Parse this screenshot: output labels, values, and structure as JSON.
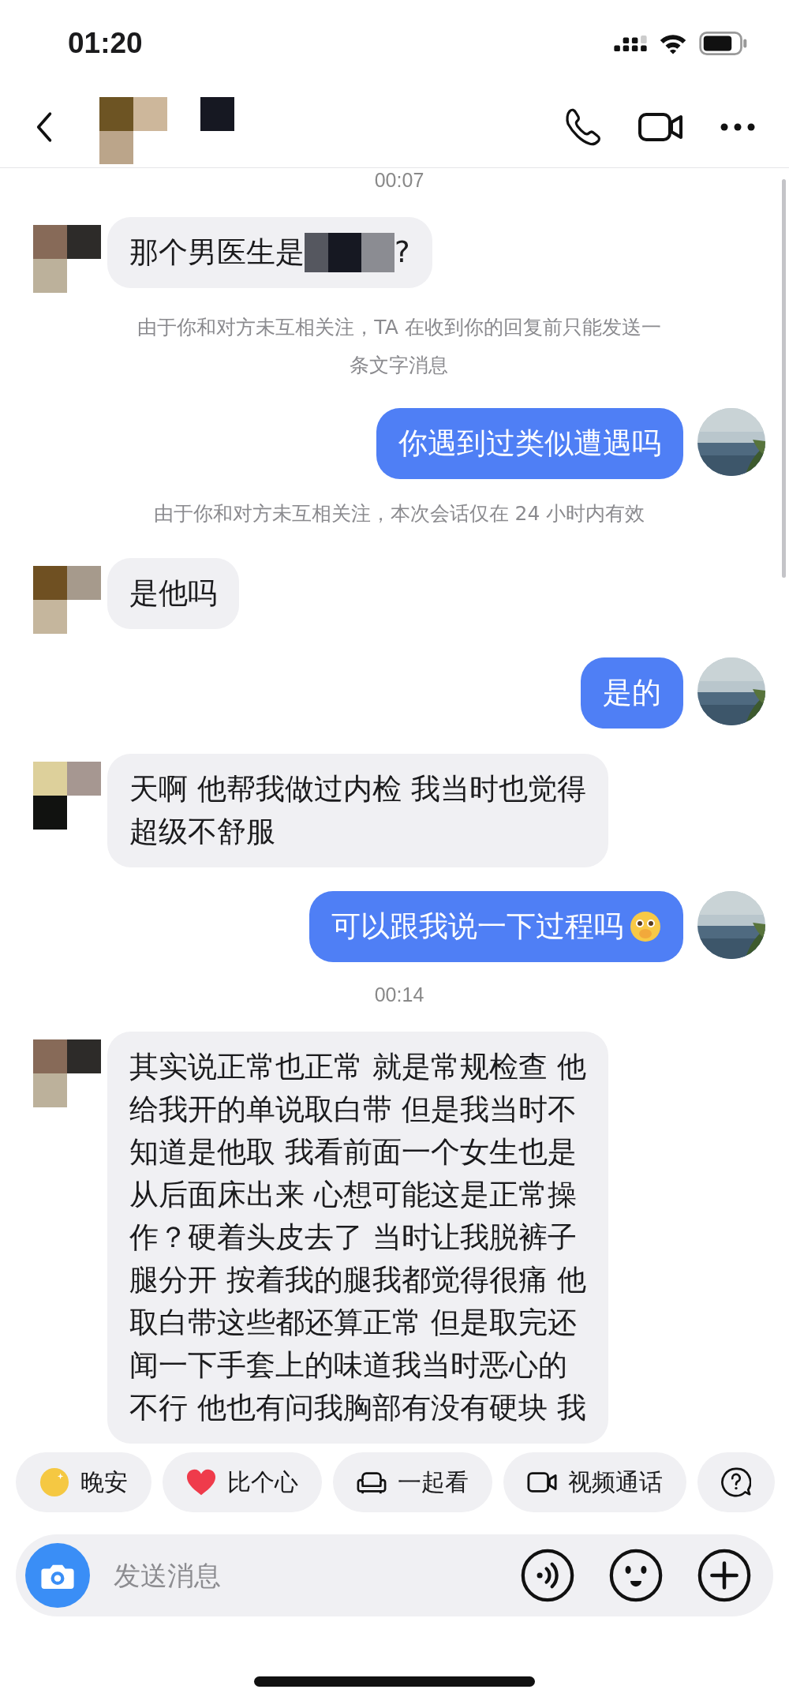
{
  "status_bar": {
    "time": "01:20"
  },
  "messages": [
    {
      "kind": "time",
      "text": "00:07"
    },
    {
      "kind": "incoming",
      "lines": [
        "那个男医生是"
      ],
      "redacted": true,
      "text_after": "?"
    },
    {
      "kind": "notice",
      "lines": [
        "由于你和对方未互相关注，TA 在收到你的回复前只能发送一",
        "条文字消息"
      ]
    },
    {
      "kind": "outgoing",
      "lines": [
        "你遇到过类似遭遇吗"
      ]
    },
    {
      "kind": "notice",
      "lines": [
        "由于你和对方未互相关注，本次会话仅在 24 小时内有效"
      ]
    },
    {
      "kind": "incoming",
      "lines": [
        "是他吗"
      ]
    },
    {
      "kind": "outgoing",
      "lines": [
        "是的"
      ]
    },
    {
      "kind": "incoming",
      "lines": [
        "天啊 他帮我做过内检 我当时也觉得",
        "超级不舒服"
      ]
    },
    {
      "kind": "outgoing",
      "lines": [
        "可以跟我说一下过程吗"
      ],
      "has_emoji": true
    },
    {
      "kind": "time",
      "text": "00:14"
    },
    {
      "kind": "incoming",
      "lines": [
        "其实说正常也正常 就是常规检查 他",
        "给我开的单说取白带 但是我当时不",
        "知道是他取 我看前面一个女生也是",
        "从后面床出来 心想可能这是正常操",
        "作？硬着头皮去了 当时让我脱裤子",
        "腿分开 按着我的腿我都觉得很痛 他",
        "取白带这些都还算正常 但是取完还",
        "闻一下手套上的味道我当时恶心的",
        "不行 他也有问我胸部有没有硬块 我"
      ]
    }
  ],
  "quick_actions": [
    {
      "kind": "moon",
      "label": "晚安"
    },
    {
      "kind": "heart",
      "label": "比个心"
    },
    {
      "kind": "sofa",
      "label": "一起看"
    },
    {
      "kind": "video",
      "label": "视频通话"
    },
    {
      "kind": "question"
    }
  ],
  "composer": {
    "placeholder": "发送消息"
  }
}
